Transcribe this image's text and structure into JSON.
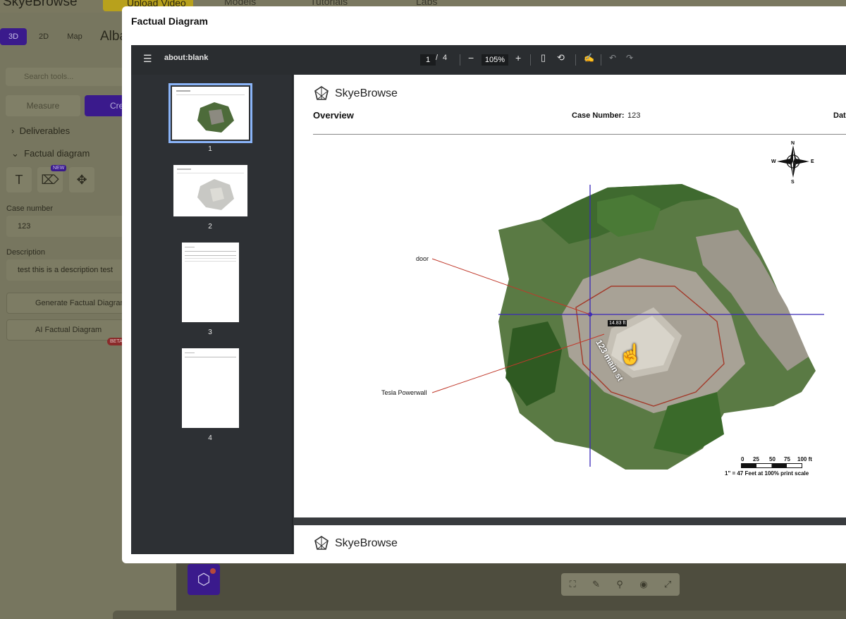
{
  "app": {
    "logo": "SkyeBrowse",
    "upload_label": "Upload Video",
    "nav": [
      "Models",
      "Tutorials",
      "Labs"
    ],
    "view_modes": [
      "3D",
      "2D",
      "Map"
    ],
    "album_title": "Alba",
    "search_placeholder": "Search tools...",
    "tabs": [
      "Measure",
      "Cre"
    ],
    "sections": [
      "Deliverables",
      "Factual diagram"
    ],
    "tool_badge": "NEW",
    "case_number_label": "Case number",
    "case_number_value": "123",
    "description_label": "Description",
    "description_value": "test this is a description test",
    "generate_button": "Generate Factual Diagram",
    "ai_button": "AI Factual Diagram",
    "ai_badge": "BETA"
  },
  "modal": {
    "title": "Factual Diagram"
  },
  "pdf_viewer": {
    "doc_title": "about:blank",
    "current_page": "1",
    "page_sep": "/",
    "total_pages": "4",
    "zoom": "105%",
    "thumbnails": [
      "1",
      "2",
      "3",
      "4"
    ],
    "selected_thumbnail": 1
  },
  "page": {
    "brand": "SkyeBrowse",
    "heading": "Overview",
    "case_number_label": "Case Number:",
    "case_number_value": "123",
    "date_label": "Date",
    "annotations": {
      "door": "door",
      "tesla": "Tesla Powerwall",
      "distance": "14.83 ft",
      "street": "123 main st"
    },
    "compass": {
      "n": "N",
      "s": "S",
      "e": "E",
      "w": "W"
    },
    "scale": {
      "ticks": [
        "0",
        "25",
        "50",
        "75",
        "100 ft"
      ],
      "note": "1\" = 47 Feet at 100% print scale"
    }
  },
  "colors": {
    "accent": "#3a1a8c",
    "pdf_toolbar": "#2a2d30",
    "thumb_selected": "#8ab4f8",
    "crosshair": "#3b2ab8",
    "annotation_line": "#c0392b"
  }
}
